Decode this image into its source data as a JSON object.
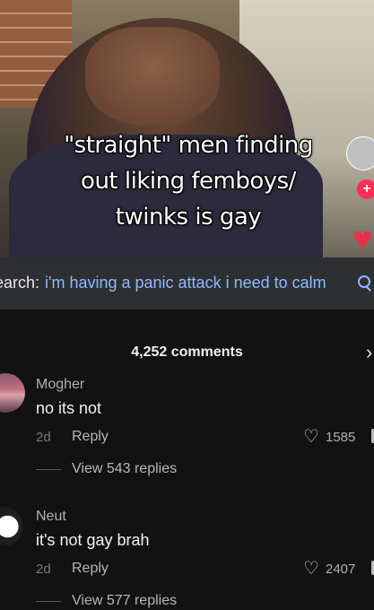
{
  "video": {
    "caption_line1": "\"straight\" men finding",
    "caption_line2": "out liking femboys/",
    "caption_line3": "twinks is gay",
    "follow_symbol": "+",
    "like_symbol": "♥"
  },
  "search": {
    "prefix": "earch:",
    "query": "i'm having a panic attack i need to calm"
  },
  "comments": {
    "count_label": "4,252 comments",
    "close_symbol": "›",
    "items": [
      {
        "username": "Mogher",
        "text": "no its not",
        "date": "2d",
        "reply_label": "Reply",
        "likes": "1585",
        "view_replies": "View 543 replies"
      },
      {
        "username": "Neut",
        "text": "it's not gay brah",
        "date": "2d",
        "reply_label": "Reply",
        "likes": "2407",
        "view_replies": "View 577 replies"
      }
    ]
  },
  "colors": {
    "accent_link": "#8eb9ff",
    "like_red": "#e8304a",
    "follow_pink": "#ff2c55",
    "panel_bg": "#121212"
  },
  "icons": [
    "search-icon",
    "heart-icon",
    "plus-icon",
    "close-icon"
  ]
}
